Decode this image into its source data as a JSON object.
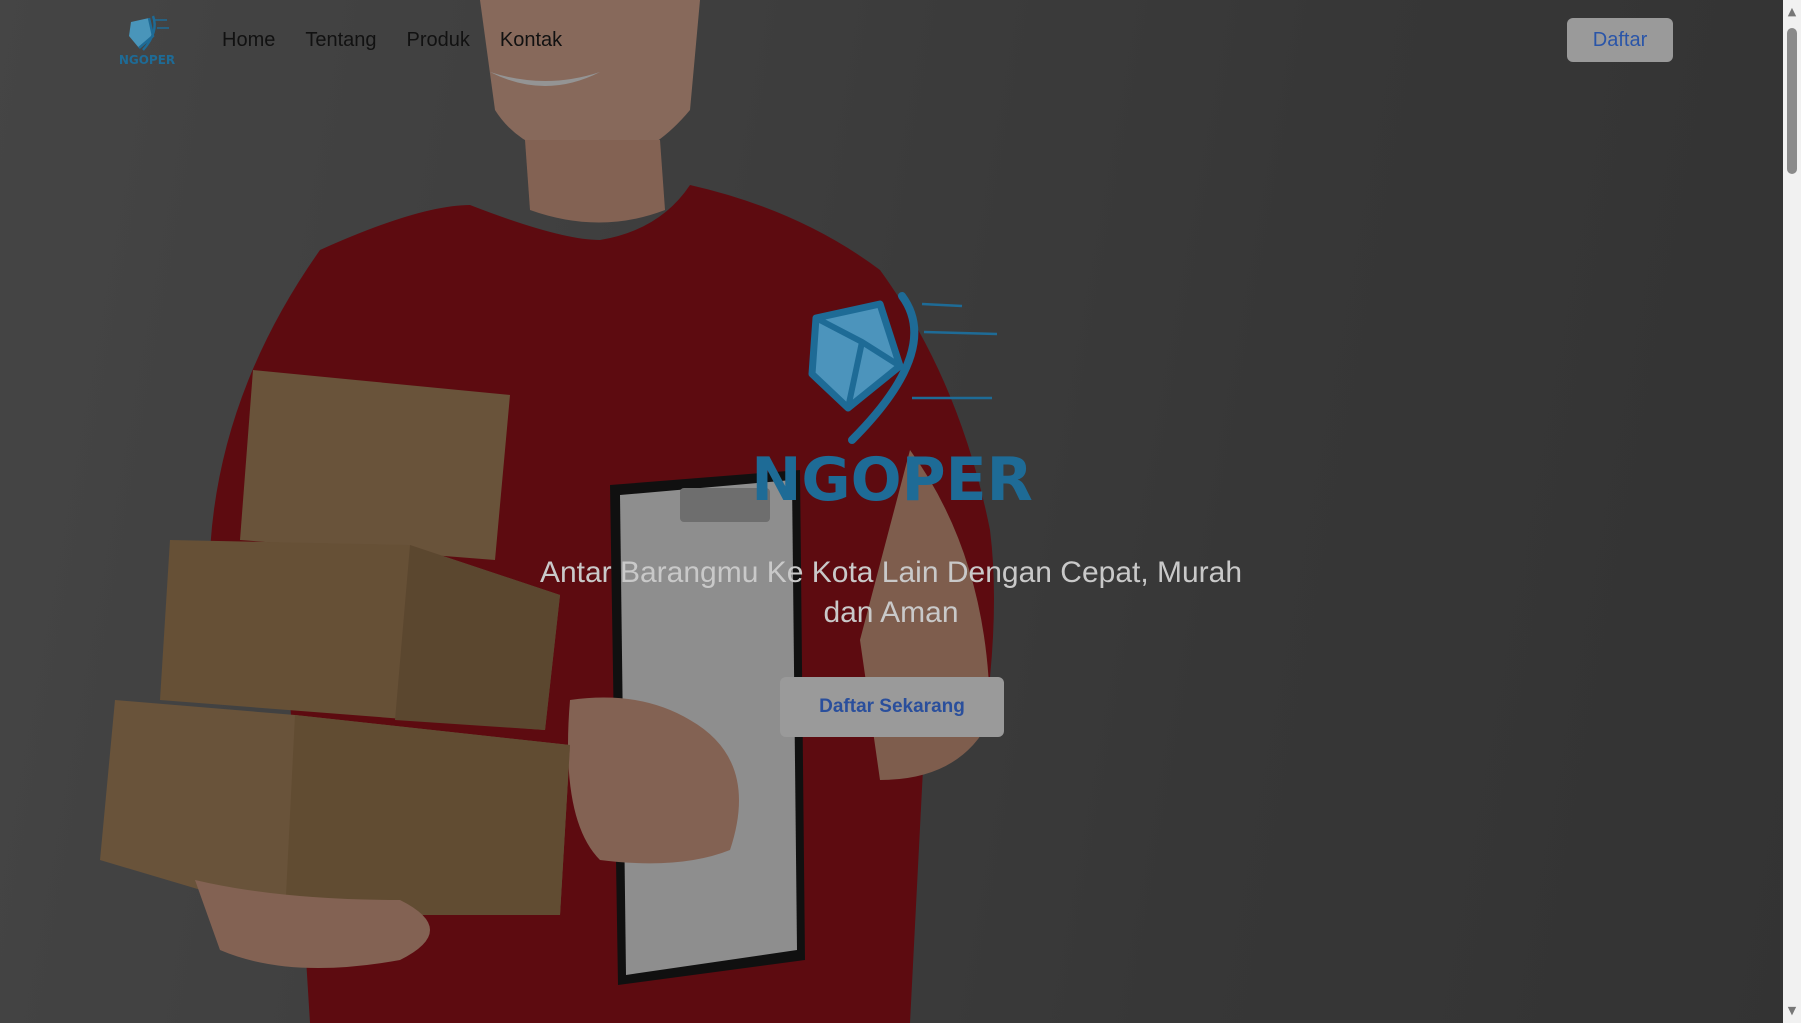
{
  "brand": {
    "name": "NGOPER",
    "logo_color": "#1e6b96",
    "logo_accent": "#4aa3cf"
  },
  "navbar": {
    "links": [
      {
        "label": "Home"
      },
      {
        "label": "Tentang"
      },
      {
        "label": "Produk"
      },
      {
        "label": "Kontak"
      }
    ],
    "cta_label": "Daftar"
  },
  "hero": {
    "tagline": "Antar Barangmu Ke Kota Lain Dengan Cepat, Murah dan Aman",
    "cta_label": "Daftar Sekarang",
    "image_alt": "delivery-man-holding-boxes-and-clipboard"
  },
  "colors": {
    "overlay": "rgba(0,0,0,0.42)",
    "button_bg": "#9a9a9a",
    "button_text": "#2a55a8",
    "shirt": "#a0141c",
    "box": "#b58f64"
  },
  "scrollbar": {
    "up_icon": "triangle-up-icon",
    "down_icon": "triangle-down-icon"
  }
}
